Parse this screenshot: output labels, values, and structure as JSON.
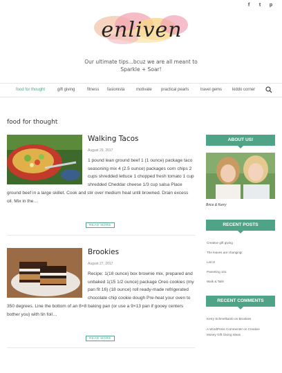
{
  "social": {
    "facebook": "f",
    "twitter": "t",
    "pinterest": "p"
  },
  "site": {
    "logo_text": "enliven",
    "tagline": "Our ultimate tips...bcuz we are all meant to Sparkle + Soar!"
  },
  "nav": {
    "items": [
      {
        "label": "food for thought",
        "active": true
      },
      {
        "label": "gift giving"
      },
      {
        "label": "fitness"
      },
      {
        "label": "fasionista"
      },
      {
        "label": "motivate"
      },
      {
        "label": "practical pearls"
      },
      {
        "label": "travel gems"
      },
      {
        "label": "kiddo corner"
      }
    ],
    "search_icon": "search-icon"
  },
  "main": {
    "section_title": "food for thought",
    "posts": [
      {
        "title": "Walking Tacos",
        "date": "August 29, 2017",
        "excerpt": "1 pound lean ground beef 1 (1 ounce) package taco seasoning mix 4 (2.5 ounce) packages corn chips 2 cups shredded lettuce 1 chopped fresh tomato 1 cup shredded Cheddar cheese 1/3 cup salsa Place ground beef in a large skillet. Cook and stir over medium heat until browned. Drain excess oil. Mix in the…",
        "read_more": "READ MORE"
      },
      {
        "title": "Brookies",
        "date": "August 27, 2017",
        "excerpt": "Recipe: 1(18 ounce) box brownie mix, prepared and unbaked 1(15 1/2 ounce) package Oreo cookies (my pan fit 16) (18 ounce) roll ready-made refrigerated chocolate chip cookie dough Pre-heat your oven to 350 degrees. Line the bottom of an 8×8 baking pan (or use a 9×13 pan if gooey centers bother you) with tin foil…",
        "read_more": "READ MORE"
      }
    ]
  },
  "sidebar": {
    "about": {
      "heading": "ABOUT US!",
      "caption": "Brice & Kerry"
    },
    "recent_posts": {
      "heading": "RECENT POSTS",
      "items": [
        "Creative gift giving",
        "The leaves are changing!",
        "List it!",
        "Parenting 101",
        "Walk & Talk!"
      ]
    },
    "recent_comments": {
      "heading": "RECENT COMMENTS",
      "items": [
        "Kerry Schmelkamb on Brookies",
        "A WordPress Commenter on Creative",
        "Money Gift Giving Ideas"
      ]
    }
  },
  "colors": {
    "accent": "#4fa387",
    "text": "#333333"
  }
}
